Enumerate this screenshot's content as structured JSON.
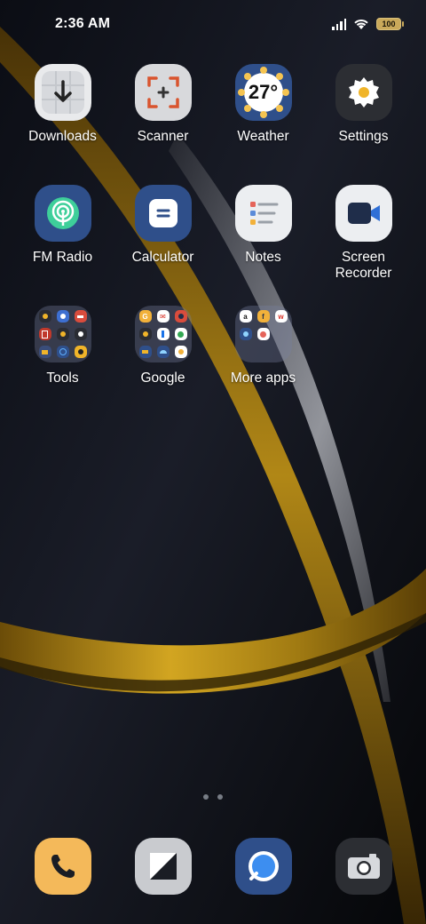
{
  "status": {
    "time": "2:36 AM",
    "battery": "100",
    "icons": [
      "signal-icon",
      "wifi-icon",
      "battery-icon"
    ]
  },
  "apps": [
    {
      "label": "Downloads",
      "icon": "downloads-icon"
    },
    {
      "label": "Scanner",
      "icon": "scanner-icon"
    },
    {
      "label": "Weather",
      "icon": "weather-icon",
      "temp": "27°"
    },
    {
      "label": "Settings",
      "icon": "settings-icon"
    },
    {
      "label": "FM Radio",
      "icon": "fm-radio-icon"
    },
    {
      "label": "Calculator",
      "icon": "calculator-icon"
    },
    {
      "label": "Notes",
      "icon": "notes-icon"
    },
    {
      "label_line1": "Screen",
      "label_line2": "Recorder",
      "icon": "screen-recorder-icon"
    }
  ],
  "folders": [
    {
      "label": "Tools"
    },
    {
      "label": "Google"
    },
    {
      "label": "More apps"
    }
  ],
  "dock": [
    {
      "name": "phone",
      "icon": "phone-icon"
    },
    {
      "name": "gallery",
      "icon": "gallery-icon"
    },
    {
      "name": "messages",
      "icon": "messages-icon"
    },
    {
      "name": "camera",
      "icon": "camera-icon"
    }
  ],
  "page_indicator": {
    "pages": 2,
    "current": 1
  },
  "colors": {
    "gold": "#c79a1a",
    "background": "#05060a"
  }
}
